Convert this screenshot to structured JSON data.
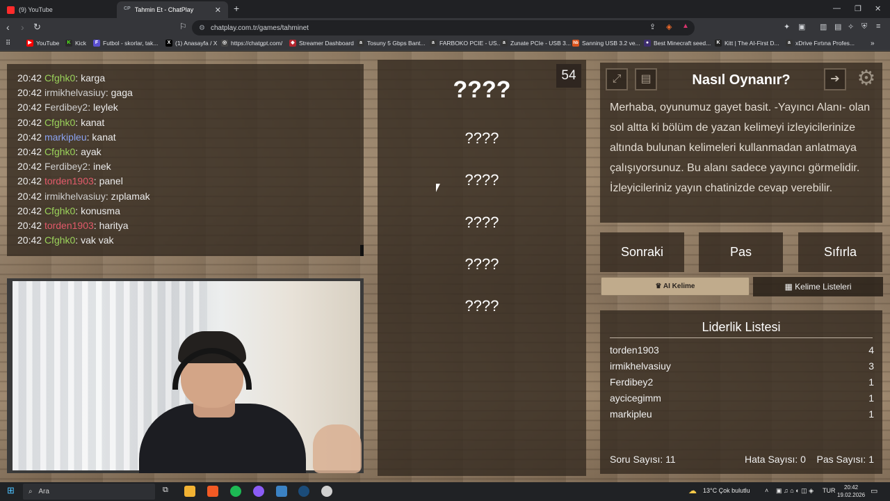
{
  "browser": {
    "tabs": [
      {
        "label": "(9) YouTube",
        "favicon": "youtube-icon"
      },
      {
        "label": "Tahmin Et - ChatPlay",
        "favicon": "chatplay-icon",
        "fav_text": "CP"
      }
    ],
    "url": "chatplay.com.tr/games/tahminet",
    "bookmarks": [
      {
        "label": "YouTube",
        "color": "#ff0000",
        "glyph": "▶"
      },
      {
        "label": "Kick",
        "color": "#53fc18",
        "glyph": "K"
      },
      {
        "label": "Futbol - skorlar, tak...",
        "color": "#5a4fcf",
        "glyph": "F"
      },
      {
        "label": "(1) Anasayfa / X",
        "color": "#000000",
        "glyph": "X"
      },
      {
        "label": "https://chatgpt.com/",
        "color": "#444444",
        "glyph": "◎"
      },
      {
        "label": "Streamer Dashboard",
        "color": "#b3262f",
        "glyph": "◆"
      },
      {
        "label": "Tosuny 5 Gbps Bant...",
        "color": "#333333",
        "glyph": "a"
      },
      {
        "label": "FARBOKO PCIE - US...",
        "color": "#333333",
        "glyph": "a"
      },
      {
        "label": "Zunate PCIe - USB 3...",
        "color": "#333333",
        "glyph": "a"
      },
      {
        "label": "Sanning USB 3.2 ve...",
        "color": "#d9541e",
        "glyph": "hb"
      },
      {
        "label": "Best Minecraft seed...",
        "color": "#3d2d6e",
        "glyph": "●"
      },
      {
        "label": "Kitt | The AI-First D...",
        "color": "#222222",
        "glyph": "K"
      },
      {
        "label": "xDrive Fırtına Profes...",
        "color": "#333333",
        "glyph": "a"
      }
    ]
  },
  "chat": {
    "messages": [
      {
        "time": "20:42",
        "user": "Cfghk0",
        "color": "green",
        "text": "karga"
      },
      {
        "time": "20:42",
        "user": "irmikhelvasiuy",
        "color": "grey",
        "text": "gaga"
      },
      {
        "time": "20:42",
        "user": "Ferdibey2",
        "color": "grey",
        "text": "leylek"
      },
      {
        "time": "20:42",
        "user": "Cfghk0",
        "color": "green",
        "text": "kanat"
      },
      {
        "time": "20:42",
        "user": "markipleu",
        "color": "blue",
        "text": "kanat"
      },
      {
        "time": "20:42",
        "user": "Cfghk0",
        "color": "green",
        "text": "ayak"
      },
      {
        "time": "20:42",
        "user": "Ferdibey2",
        "color": "grey",
        "text": "inek"
      },
      {
        "time": "20:42",
        "user": "torden1903",
        "color": "red",
        "text": "panel"
      },
      {
        "time": "20:42",
        "user": "irmikhelvasiuy",
        "color": "grey",
        "text": "zıplamak"
      },
      {
        "time": "20:42",
        "user": "Cfghk0",
        "color": "green",
        "text": "konusma"
      },
      {
        "time": "20:42",
        "user": "torden1903",
        "color": "red",
        "text": "haritya"
      },
      {
        "time": "20:42",
        "user": "Cfghk0",
        "color": "green",
        "text": "vak vak"
      }
    ]
  },
  "game": {
    "timer": "54",
    "main_word": "????",
    "forbidden_words": [
      "????",
      "????",
      "????",
      "????",
      "????"
    ]
  },
  "howto": {
    "title": "Nasıl Oynanır?",
    "description": "Merhaba, oyunumuz gayet basit. -Yayıncı Alanı- olan sol altta ki bölüm de yazan kelimeyi izleyicilerinize altında bulunan kelimeleri kullanmadan anlatmaya çalışıyorsunuz. Bu alanı sadece yayıncı görmelidir. İzleyicileriniz yayın chatinizde cevap verebilir."
  },
  "controls": {
    "next": "Sonraki",
    "pass": "Pas",
    "reset": "Sıfırla",
    "ai_word": "AI Kelime",
    "word_lists": "Kelime Listeleri"
  },
  "leaderboard": {
    "title": "Liderlik Listesi",
    "rows": [
      {
        "name": "torden1903",
        "score": "4"
      },
      {
        "name": "irmikhelvasiuy",
        "score": "3"
      },
      {
        "name": "Ferdibey2",
        "score": "1"
      },
      {
        "name": "aycicegimm",
        "score": "1"
      },
      {
        "name": "markipleu",
        "score": "1"
      }
    ],
    "question_count": "Soru Sayısı: 11",
    "error_count": "Hata Sayısı: 0",
    "pass_count": "Pas Sayısı: 1"
  },
  "taskbar": {
    "search_placeholder": "Ara",
    "weather": "13°C  Çok bulutlu",
    "lang": "TUR",
    "time": "20:42",
    "date": "19.02.2026"
  }
}
